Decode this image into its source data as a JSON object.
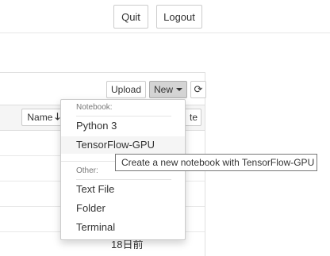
{
  "header": {
    "quit_label": "Quit",
    "logout_label": "Logout"
  },
  "toolbar": {
    "upload_label": "Upload",
    "new_label": "New",
    "refresh_icon": "refresh-icon"
  },
  "list_header": {
    "name_label": "Name",
    "name_sort_icon": "arrow-down-icon",
    "last_modified_partial": "te"
  },
  "rows": {
    "last_time_partial": "18日前"
  },
  "new_menu": {
    "notebook_header": "Notebook:",
    "notebook_items": [
      "Python 3",
      "TensorFlow-GPU"
    ],
    "other_header": "Other:",
    "other_items": [
      "Text File",
      "Folder",
      "Terminal"
    ]
  },
  "tooltip": {
    "text": "Create a new notebook with TensorFlow-GPU"
  }
}
